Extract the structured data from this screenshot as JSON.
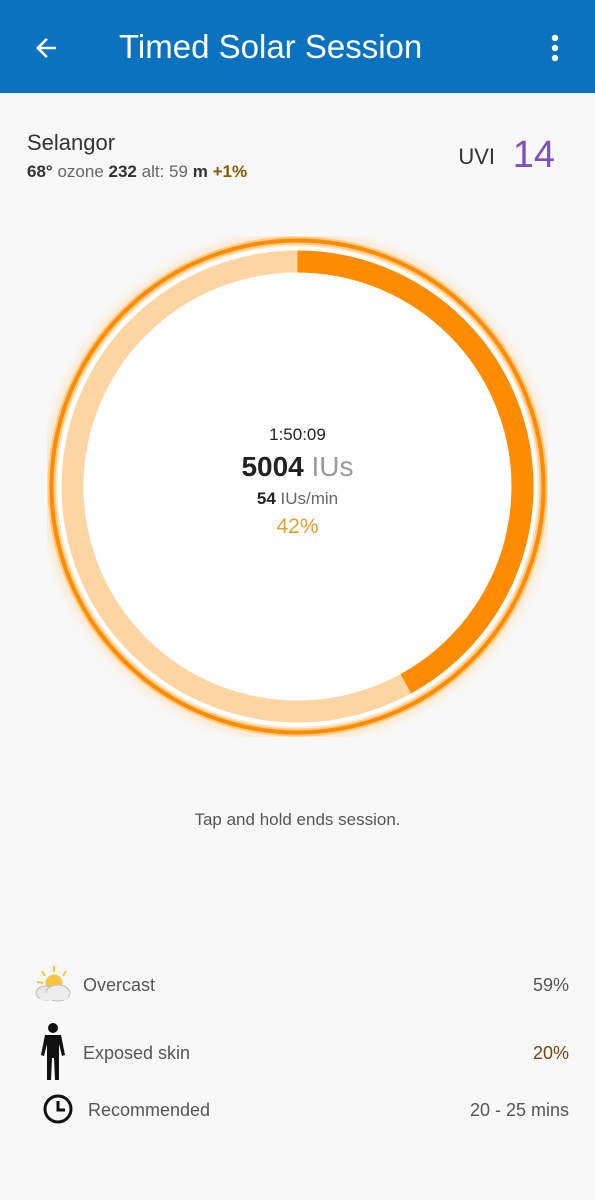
{
  "app_bar": {
    "title": "Timed Solar Session",
    "back_icon": "arrow-left-icon",
    "menu_icon": "more-vert-icon",
    "background": "#0a72bf"
  },
  "location": {
    "name": "Selangor",
    "sun_angle": "68°",
    "ozone_label": "ozone",
    "ozone_value": "232",
    "alt_label": "alt:",
    "alt_value": "59",
    "alt_unit": "m",
    "delta": "+1%"
  },
  "uvi": {
    "label": "UVI",
    "value": "14",
    "color": "#7d4fc0"
  },
  "session": {
    "elapsed": "1:50:09",
    "total_value": "5004",
    "total_unit": "IUs",
    "rate_value": "54",
    "rate_unit": "IUs/min",
    "percent": "42%",
    "progress_fraction": 0.42,
    "ring_color": "#ff8c00",
    "ring_track_color": "#fdd5a3"
  },
  "hint": "Tap and hold ends session.",
  "factors": [
    {
      "icon": "partly-cloudy-icon",
      "label": "Overcast",
      "value": "59%"
    },
    {
      "icon": "human-figure-icon",
      "label": "Exposed skin",
      "value": "20%"
    },
    {
      "icon": "clock-icon",
      "label": "Recommended",
      "value": "20 - 25 mins"
    }
  ]
}
